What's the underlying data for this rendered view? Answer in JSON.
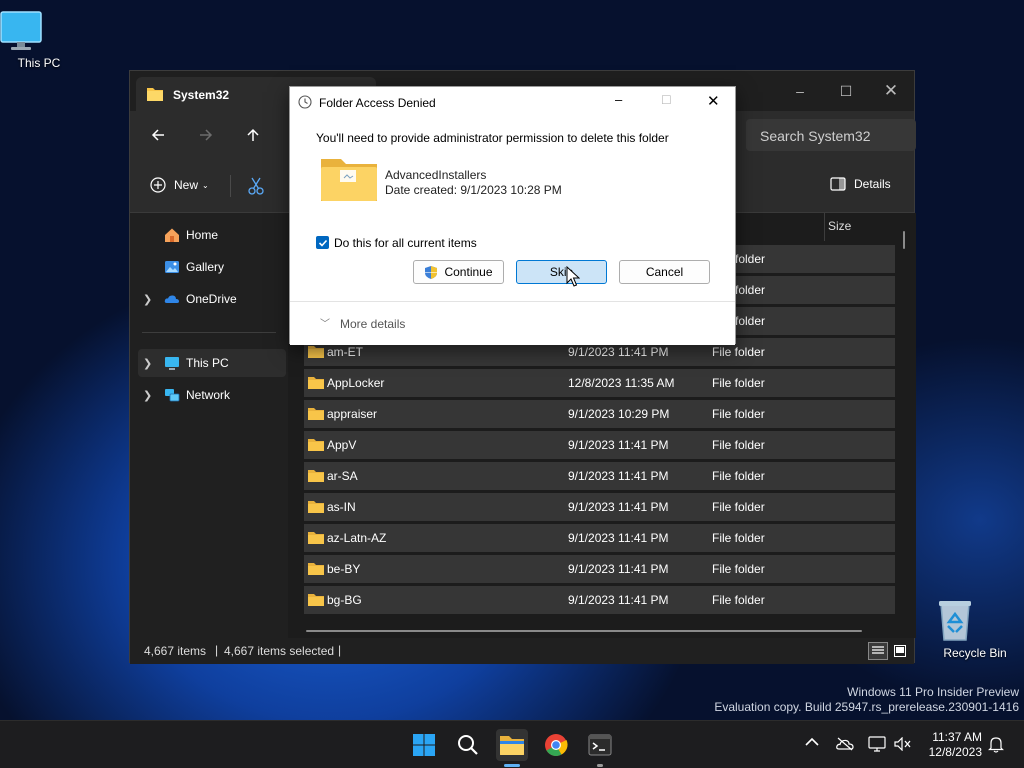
{
  "desktop": {
    "this_pc_label": "This PC",
    "recycle_bin_label": "Recycle Bin",
    "watermark_line1": "Windows 11 Pro Insider Preview",
    "watermark_line2": "Evaluation copy. Build 25947.rs_prerelease.230901-1416"
  },
  "explorer": {
    "tab_title": "System32",
    "search_placeholder": "Search System32",
    "toolbar": {
      "new_label": "New",
      "details_label": "Details"
    },
    "sidebar": {
      "items": [
        {
          "label": "Home",
          "icon": "home-icon"
        },
        {
          "label": "Gallery",
          "icon": "gallery-icon"
        },
        {
          "label": "OneDrive",
          "icon": "onedrive-icon"
        },
        {
          "label": "This PC",
          "icon": "computer-icon"
        },
        {
          "label": "Network",
          "icon": "network-icon"
        }
      ]
    },
    "columns": {
      "size": "Size"
    },
    "partial_type": "folder",
    "rows": [
      {
        "name": "am-ET",
        "date": "9/1/2023 11:41 PM",
        "type": "File folder"
      },
      {
        "name": "AppLocker",
        "date": "12/8/2023 11:35 AM",
        "type": "File folder"
      },
      {
        "name": "appraiser",
        "date": "9/1/2023 10:29 PM",
        "type": "File folder"
      },
      {
        "name": "AppV",
        "date": "9/1/2023 11:41 PM",
        "type": "File folder"
      },
      {
        "name": "ar-SA",
        "date": "9/1/2023 11:41 PM",
        "type": "File folder"
      },
      {
        "name": "as-IN",
        "date": "9/1/2023 11:41 PM",
        "type": "File folder"
      },
      {
        "name": "az-Latn-AZ",
        "date": "9/1/2023 11:41 PM",
        "type": "File folder"
      },
      {
        "name": "be-BY",
        "date": "9/1/2023 11:41 PM",
        "type": "File folder"
      },
      {
        "name": "bg-BG",
        "date": "9/1/2023 11:41 PM",
        "type": "File folder"
      }
    ],
    "status": {
      "count": "4,667 items",
      "selected": "4,667 items selected"
    }
  },
  "dialog": {
    "title": "Folder Access Denied",
    "message": "You'll need to provide administrator permission to delete this folder",
    "folder_name": "AdvancedInstallers",
    "date_created": "Date created: 9/1/2023 10:28 PM",
    "checkbox_label": "Do this for all current items",
    "checkbox_checked": true,
    "continue_label": "Continue",
    "skip_label": "Skip",
    "cancel_label": "Cancel",
    "more_details_label": "More details"
  },
  "taskbar": {
    "time": "11:37 AM",
    "date": "12/8/2023"
  },
  "colors": {
    "accent": "#0078d4",
    "folder": "#f8c549",
    "dark_bg": "#191919"
  }
}
